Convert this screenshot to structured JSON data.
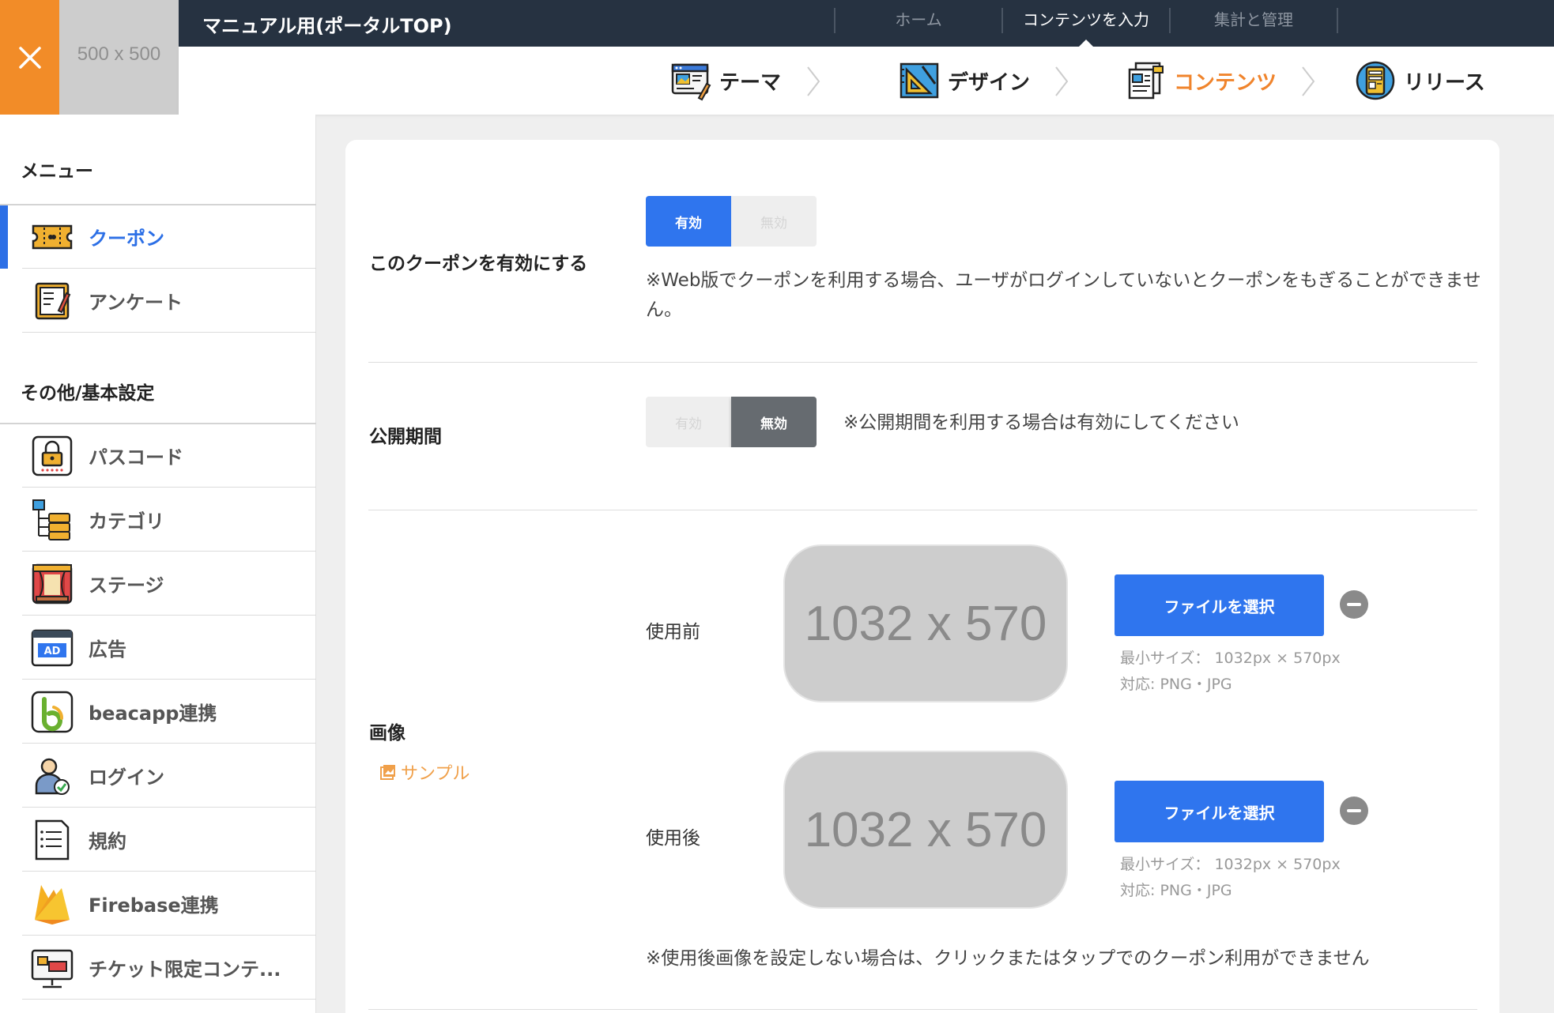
{
  "header": {
    "thumbnail_text": "500 x 500",
    "app_title": "マニュアル用(ポータルTOP)",
    "nav": [
      {
        "label": "ホーム",
        "active": false
      },
      {
        "label": "コンテンツを入力",
        "active": true
      },
      {
        "label": "集計と管理",
        "active": false
      }
    ],
    "steps": [
      {
        "label": "テーマ",
        "icon": "theme-icon",
        "active": false
      },
      {
        "label": "デザイン",
        "icon": "design-icon",
        "active": false
      },
      {
        "label": "コンテンツ",
        "icon": "content-icon",
        "active": true
      },
      {
        "label": "リリース",
        "icon": "release-icon",
        "active": false
      }
    ],
    "accent_color": "#f28c28",
    "dark_color": "#263241"
  },
  "sidebar": {
    "menu_heading": "メニュー",
    "menu_items": [
      {
        "label": "クーポン",
        "icon": "coupon-icon",
        "active": true
      },
      {
        "label": "アンケート",
        "icon": "survey-icon",
        "active": false
      }
    ],
    "other_heading": "その他/基本設定",
    "other_items": [
      {
        "label": "パスコード",
        "icon": "passcode-icon"
      },
      {
        "label": "カテゴリ",
        "icon": "category-icon"
      },
      {
        "label": "ステージ",
        "icon": "stage-icon"
      },
      {
        "label": "広告",
        "icon": "ad-icon"
      },
      {
        "label": "beacapp連携",
        "icon": "beacapp-icon"
      },
      {
        "label": "ログイン",
        "icon": "login-icon"
      },
      {
        "label": "規約",
        "icon": "terms-icon"
      },
      {
        "label": "Firebase連携",
        "icon": "firebase-icon"
      },
      {
        "label": "チケット限定コンテ...",
        "icon": "ticket-icon"
      }
    ],
    "active_color": "#2c6fe6"
  },
  "main": {
    "enable_coupon": {
      "label": "このクーポンを有効にする",
      "on_label": "有効",
      "off_label": "無効",
      "selected": "有効",
      "note": "※Web版でクーポンを利用する場合、ユーザがログインしていないとクーポンをもぎることができません。"
    },
    "publish_period": {
      "label": "公開期間",
      "on_label": "有効",
      "off_label": "無効",
      "selected": "無効",
      "note": "※公開期間を利用する場合は有効にしてください"
    },
    "image": {
      "label": "画像",
      "sample_link": "サンプル",
      "before": {
        "label": "使用前",
        "placeholder": "1032 x 570",
        "button": "ファイルを選択",
        "min_size": "最小サイズ： 1032px × 570px",
        "formats": "対応: PNG・JPG"
      },
      "after": {
        "label": "使用後",
        "placeholder": "1032 x 570",
        "button": "ファイルを選択",
        "min_size": "最小サイズ： 1032px × 570px",
        "formats": "対応: PNG・JPG"
      },
      "note": "※使用後画像を設定しない場合は、クリックまたはタップでのクーポン利用ができません"
    },
    "primary_button_color": "#2f75ee"
  }
}
